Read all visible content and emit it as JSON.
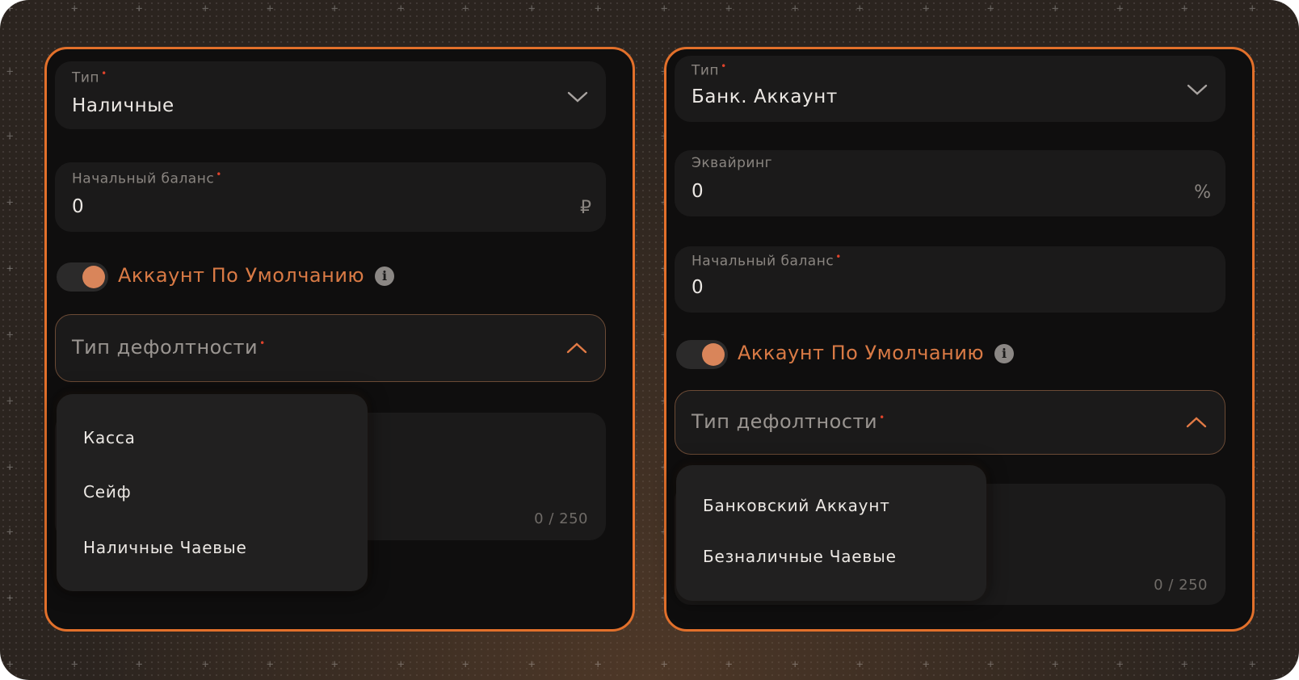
{
  "left": {
    "type_field": {
      "label": "Тип",
      "value": "Наличные"
    },
    "balance_field": {
      "label": "Начальный баланс",
      "value": "0",
      "suffix": "₽"
    },
    "default_toggle": {
      "label": "Аккаунт По Умолчанию",
      "on": true
    },
    "default_type": {
      "placeholder": "Тип дефолтности"
    },
    "dropdown_options": [
      "Касса",
      "Сейф",
      "Наличные Чаевые"
    ],
    "counter": "0 / 250"
  },
  "right": {
    "type_field": {
      "label": "Тип",
      "value": "Банк. Аккаунт"
    },
    "acquiring_field": {
      "label": "Эквайринг",
      "value": "0",
      "suffix": "%"
    },
    "balance_field": {
      "label": "Начальный баланс",
      "value": "0"
    },
    "default_toggle": {
      "label": "Аккаунт По Умолчанию",
      "on": true
    },
    "default_type": {
      "placeholder": "Тип дефолтности"
    },
    "dropdown_options": [
      "Банковский Аккаунт",
      "Безналичные Чаевые"
    ],
    "counter": "0 / 250"
  },
  "colors": {
    "accent": "#e2702b",
    "required": "#e0432b",
    "panel_bg": "#0f0e0e",
    "field_bg": "#1b1a1a"
  }
}
